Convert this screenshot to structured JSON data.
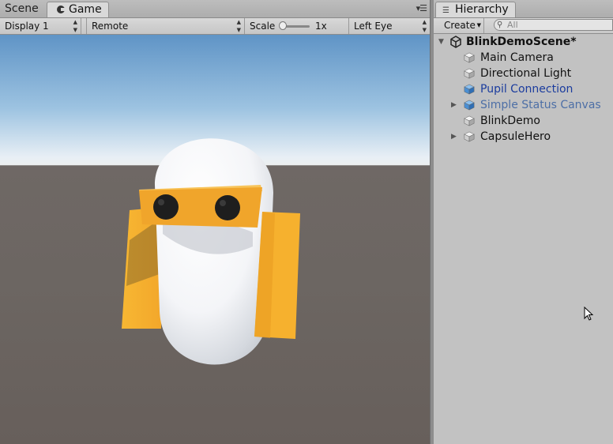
{
  "game_panel": {
    "tabs": {
      "scene": "Scene",
      "game": "Game"
    },
    "menu_icon": "panel-menu-icon",
    "toolbar": {
      "display": "Display 1",
      "remote": "Remote",
      "scale_label": "Scale",
      "scale_value": "1x",
      "eye": "Left Eye"
    }
  },
  "hierarchy": {
    "tab_label": "Hierarchy",
    "create_label": "Create",
    "search_placeholder": "All",
    "scene": "BlinkDemoScene*",
    "items": [
      {
        "label": "Main Camera",
        "expandable": false,
        "color": "#111111",
        "icon": "gameobject-cube-icon"
      },
      {
        "label": "Directional Light",
        "expandable": false,
        "color": "#111111",
        "icon": "gameobject-cube-icon"
      },
      {
        "label": "Pupil Connection",
        "expandable": false,
        "color": "#1b3c9e",
        "icon": "prefab-cube-icon"
      },
      {
        "label": "Simple Status Canvas",
        "expandable": true,
        "color": "#4d6fa6",
        "icon": "prefab-cube-icon"
      },
      {
        "label": "BlinkDemo",
        "expandable": false,
        "color": "#111111",
        "icon": "gameobject-cube-icon"
      },
      {
        "label": "CapsuleHero",
        "expandable": true,
        "color": "#111111",
        "icon": "gameobject-cube-icon"
      }
    ]
  },
  "colors": {
    "capsule": "#f1f3f6",
    "accessory_orange": "#f2a92b",
    "eyes": "#1e1e1e",
    "ground": "#6b6460",
    "sky": "#7eaed8"
  }
}
